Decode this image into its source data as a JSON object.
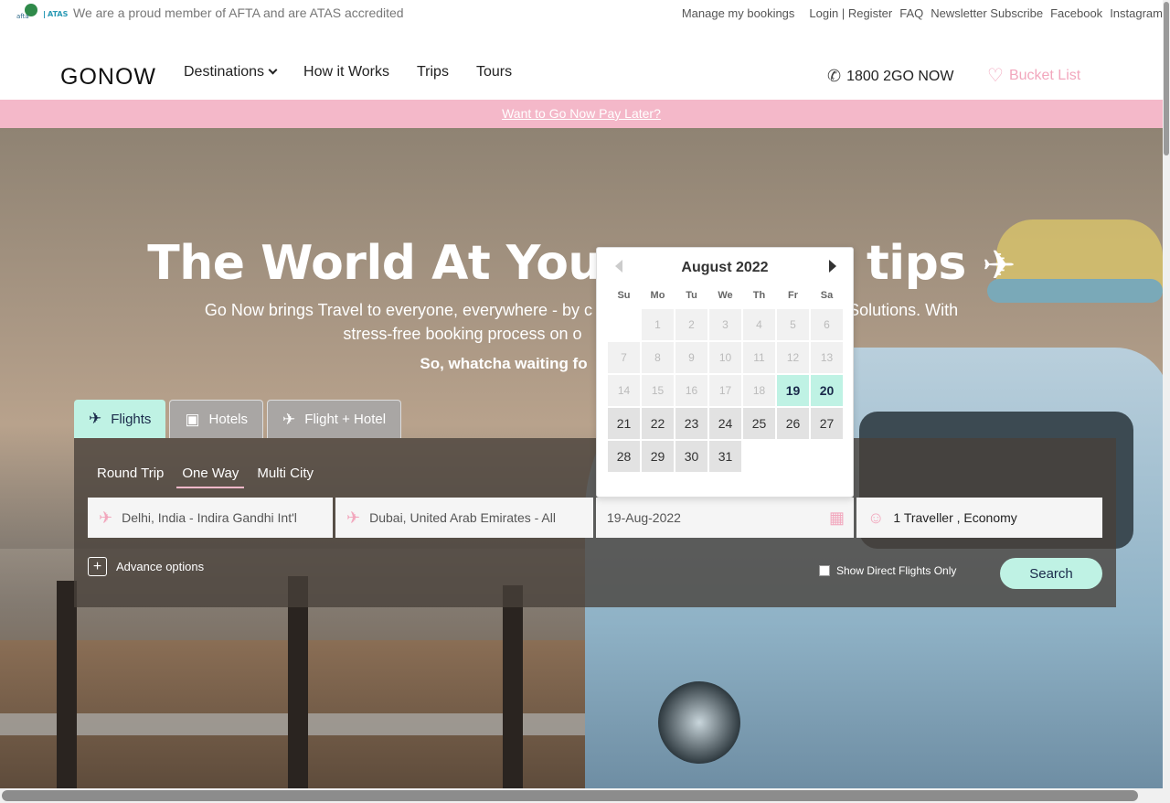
{
  "topbar": {
    "afta_text": "afta",
    "atas_text": "ATAS",
    "membership": "We are a proud member of AFTA and are ATAS accredited",
    "links": {
      "manage": "Manage my bookings",
      "login": "Login | Register",
      "faq": "FAQ",
      "newsletter": "Newsletter Subscribe",
      "facebook": "Facebook",
      "instagram": "Instagram"
    }
  },
  "nav": {
    "brand": "GONOW",
    "destinations": "Destinations",
    "how": "How it Works",
    "trips": "Trips",
    "tours": "Tours",
    "phone": "1800 2GO NOW",
    "bucket": "Bucket List"
  },
  "promo": {
    "text": "Want to Go Now Pay Later?"
  },
  "hero": {
    "title_left": "The World At You",
    "title_right": "tips",
    "subtitle_l1": "Go Now brings Travel to everyone, everywhere - by c",
    "subtitle_l1_right": "Solutions. With",
    "subtitle_l2": "stress-free booking process on o",
    "cta": "So, whatcha waiting fo"
  },
  "search": {
    "tabs": [
      "Flights",
      "Hotels",
      "Flight + Hotel"
    ],
    "trip_types": [
      "Round Trip",
      "One Way",
      "Multi City"
    ],
    "from": "Delhi, India - Indira Gandhi Int'l",
    "to": "Dubai, United Arab Emirates - All",
    "date": "19-Aug-2022",
    "travellers": "1 Traveller , Economy",
    "advance": "Advance options",
    "direct": "Show Direct Flights Only",
    "search_btn": "Search"
  },
  "datepicker": {
    "title": "August 2022",
    "dow": [
      "Su",
      "Mo",
      "Tu",
      "We",
      "Th",
      "Fr",
      "Sa"
    ],
    "days": [
      {
        "d": "",
        "s": "empty"
      },
      {
        "d": "1",
        "s": "dis"
      },
      {
        "d": "2",
        "s": "dis"
      },
      {
        "d": "3",
        "s": "dis"
      },
      {
        "d": "4",
        "s": "dis"
      },
      {
        "d": "5",
        "s": "dis"
      },
      {
        "d": "6",
        "s": "dis"
      },
      {
        "d": "7",
        "s": "dis"
      },
      {
        "d": "8",
        "s": "dis"
      },
      {
        "d": "9",
        "s": "dis"
      },
      {
        "d": "10",
        "s": "dis"
      },
      {
        "d": "11",
        "s": "dis"
      },
      {
        "d": "12",
        "s": "dis"
      },
      {
        "d": "13",
        "s": "dis"
      },
      {
        "d": "14",
        "s": "dis"
      },
      {
        "d": "15",
        "s": "dis"
      },
      {
        "d": "16",
        "s": "dis"
      },
      {
        "d": "17",
        "s": "dis"
      },
      {
        "d": "18",
        "s": "dis"
      },
      {
        "d": "19",
        "s": "hl"
      },
      {
        "d": "20",
        "s": "hl"
      },
      {
        "d": "21",
        "s": "on"
      },
      {
        "d": "22",
        "s": "on"
      },
      {
        "d": "23",
        "s": "on"
      },
      {
        "d": "24",
        "s": "on"
      },
      {
        "d": "25",
        "s": "on"
      },
      {
        "d": "26",
        "s": "on"
      },
      {
        "d": "27",
        "s": "on"
      },
      {
        "d": "28",
        "s": "on"
      },
      {
        "d": "29",
        "s": "on"
      },
      {
        "d": "30",
        "s": "on"
      },
      {
        "d": "31",
        "s": "on"
      }
    ]
  },
  "colors": {
    "mint": "#bff2e4",
    "pink": "#f4b8c9"
  },
  "icons": [
    "phone-icon",
    "heart-icon",
    "plane-icon",
    "bed-icon",
    "flight-hotel-icon",
    "takeoff-icon",
    "landing-icon",
    "calendar-icon",
    "user-icon",
    "plus-icon"
  ]
}
